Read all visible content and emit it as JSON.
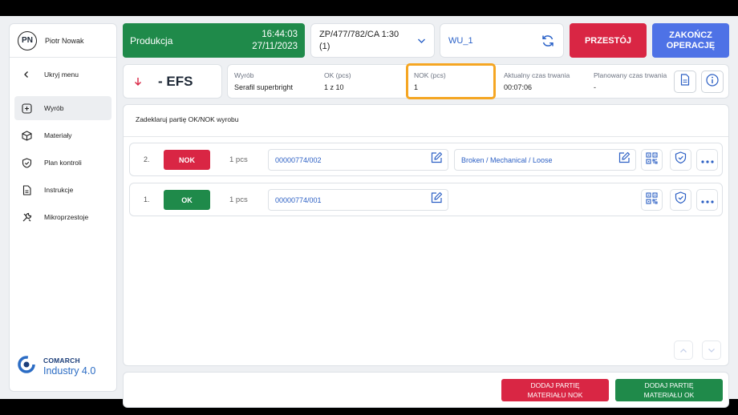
{
  "user": {
    "initials": "PN",
    "name": "Piotr Nowak"
  },
  "sidebar": {
    "items": [
      {
        "label": "Ukryj menu",
        "icon": "chevron-left-icon"
      },
      {
        "label": "Wyrób",
        "icon": "plus-square-icon",
        "active": true
      },
      {
        "label": "Materiały",
        "icon": "box-icon"
      },
      {
        "label": "Plan kontroli",
        "icon": "shield-check-icon"
      },
      {
        "label": "Instrukcje",
        "icon": "document-icon"
      },
      {
        "label": "Mikroprzestoje",
        "icon": "tools-icon"
      }
    ],
    "logo": {
      "line1": "COMARCH",
      "line2": "Industry 4.0"
    }
  },
  "header": {
    "status": "Produkcja",
    "time": "16:44:03",
    "date": "27/11/2023",
    "order_line1": "ZP/477/782/CA 1:30",
    "order_line2": "(1)",
    "station": "WU_1",
    "downtime_label": "PRZESTÓJ",
    "finish_label_line1": "ZAKOŃCZ",
    "finish_label_line2": "OPERACJĘ"
  },
  "operation": {
    "code": "- EFS"
  },
  "info": {
    "product_label": "Wyrób",
    "product_value": "Serafil superbright",
    "ok_label": "OK (pcs)",
    "ok_value": "1 z 10",
    "nok_label": "NOK (pcs)",
    "nok_value": "1",
    "actual_label": "Aktualny czas trwania",
    "actual_value": "00:07:06",
    "planned_label": "Planowany czas trwania",
    "planned_value": "-"
  },
  "main": {
    "title": "Zadeklaruj partię OK/NOK wyrobu",
    "rows": [
      {
        "num": "2.",
        "status": "NOK",
        "qty": "1 pcs",
        "batch": "00000774/002",
        "reason": "Broken / Mechanical / Loose"
      },
      {
        "num": "1.",
        "status": "OK",
        "qty": "1 pcs",
        "batch": "00000774/001"
      }
    ]
  },
  "footer": {
    "add_nok_line1": "DODAJ PARTIĘ",
    "add_nok_line2": "MATERIAŁU NOK",
    "add_ok_line1": "DODAJ PARTIĘ",
    "add_ok_line2": "MATERIAŁU OK"
  },
  "colors": {
    "green": "#1f8a4a",
    "red": "#d92644",
    "blue": "#4e72e6",
    "highlight": "#f5a623",
    "link": "#2b5fc4"
  }
}
